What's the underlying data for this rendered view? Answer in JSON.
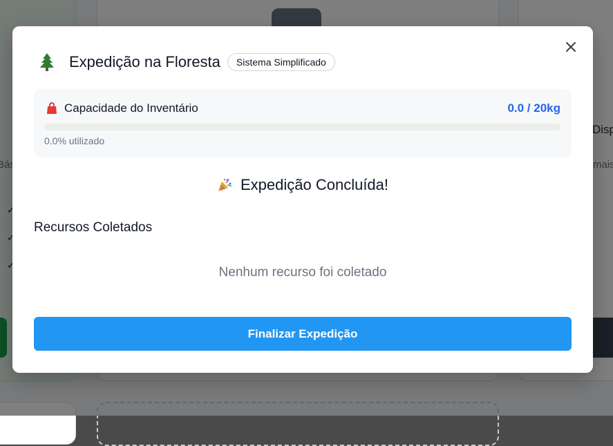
{
  "background": {
    "label_left": "Bás",
    "label_right_top": "Disp",
    "label_right_sub": "mais"
  },
  "modal": {
    "close_icon": "close-icon",
    "header": {
      "icon": "tree-icon",
      "title": "Expedição na Floresta",
      "badge": "Sistema Simplificado"
    },
    "inventory": {
      "icon": "bag-icon",
      "label": "Capacidade do Inventário",
      "value": "0.0 / 20kg",
      "used_fraction": 0.0,
      "used_text": "0.0% utilizado"
    },
    "completed": {
      "icon": "party-popper-icon",
      "text": "Expedição Concluída!"
    },
    "resources": {
      "title": "Recursos Coletados",
      "empty_text": "Nenhum recurso foi coletado"
    },
    "finish_button": "Finalizar Expedição"
  },
  "colors": {
    "accent_blue": "#2196f3",
    "value_blue": "#2563eb",
    "overlay": "rgba(0,0,0,0.5)"
  }
}
